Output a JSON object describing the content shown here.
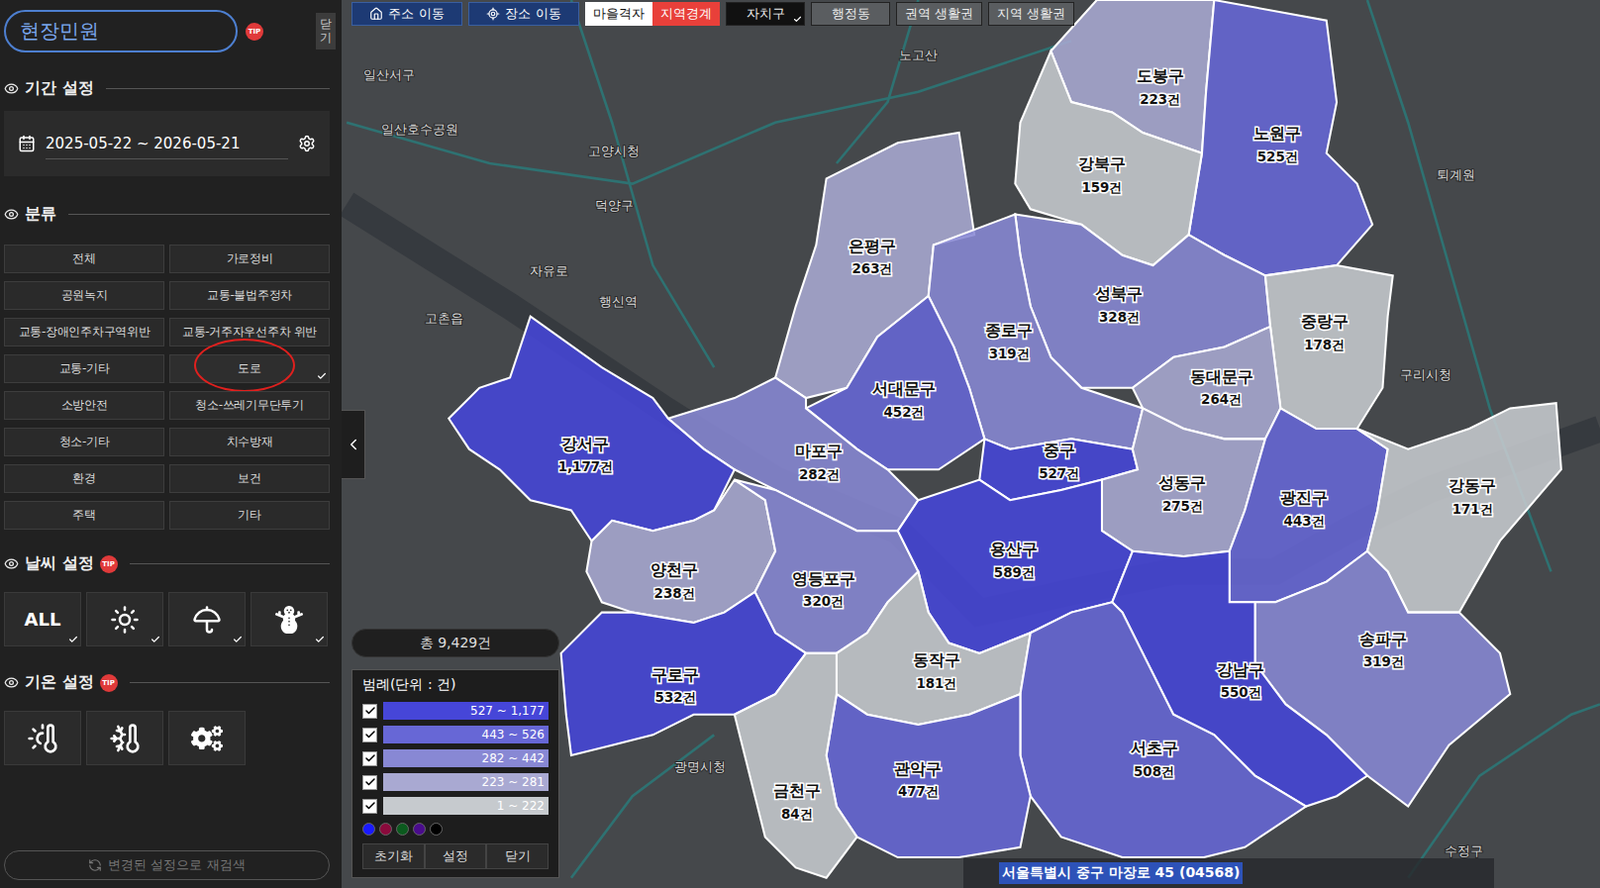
{
  "sidebar": {
    "title": "현장민원",
    "title_badge": "TIP",
    "close_tab": "닫기",
    "period": {
      "title": "기간 설정",
      "range": "2025-05-22 ~ 2026-05-21"
    },
    "category": {
      "title": "분류",
      "items": [
        {
          "label": "전체",
          "selected": false,
          "circled": false
        },
        {
          "label": "가로정비",
          "selected": false,
          "circled": false
        },
        {
          "label": "공원녹지",
          "selected": false,
          "circled": false
        },
        {
          "label": "교통-불법주정차",
          "selected": false,
          "circled": false
        },
        {
          "label": "교통-장애인주차구역위반",
          "selected": false,
          "circled": false
        },
        {
          "label": "교통-거주자우선주차 위반",
          "selected": false,
          "circled": false
        },
        {
          "label": "교통-기타",
          "selected": false,
          "circled": false
        },
        {
          "label": "도로",
          "selected": true,
          "circled": true
        },
        {
          "label": "소방안전",
          "selected": false,
          "circled": false
        },
        {
          "label": "청소-쓰레기무단투기",
          "selected": false,
          "circled": false
        },
        {
          "label": "청소-기타",
          "selected": false,
          "circled": false
        },
        {
          "label": "치수방재",
          "selected": false,
          "circled": false
        },
        {
          "label": "환경",
          "selected": false,
          "circled": false
        },
        {
          "label": "보건",
          "selected": false,
          "circled": false
        },
        {
          "label": "주택",
          "selected": false,
          "circled": false
        },
        {
          "label": "기타",
          "selected": false,
          "circled": false
        }
      ]
    },
    "weather": {
      "title": "날씨 설정",
      "badge": "TIP",
      "items": [
        {
          "kind": "text",
          "label": "ALL",
          "checked": true
        },
        {
          "kind": "sun",
          "checked": true
        },
        {
          "kind": "rain",
          "checked": true
        },
        {
          "kind": "snow",
          "checked": true
        }
      ]
    },
    "temperature": {
      "title": "기온 설정",
      "badge": "TIP",
      "items": [
        {
          "kind": "hot"
        },
        {
          "kind": "cold"
        },
        {
          "kind": "settings"
        }
      ]
    },
    "research_button": "변경된 설정으로 재검색"
  },
  "toolbar": {
    "nav": [
      {
        "label": "주소 이동",
        "kind": "home"
      },
      {
        "label": "장소 이동",
        "kind": "target"
      }
    ],
    "layer": [
      {
        "label": "마을격자",
        "selected": false
      },
      {
        "label": "지역경계",
        "selected": true
      }
    ],
    "levels": [
      {
        "label": "자치구",
        "selected": true
      },
      {
        "label": "행정동",
        "selected": false
      },
      {
        "label": "권역 생활권",
        "selected": false
      },
      {
        "label": "지역 생활권",
        "selected": false
      }
    ]
  },
  "map": {
    "districts": [
      {
        "name": "도봉구",
        "count": "223건"
      },
      {
        "name": "노원구",
        "count": "525건"
      },
      {
        "name": "강북구",
        "count": "159건"
      },
      {
        "name": "은평구",
        "count": "263건"
      },
      {
        "name": "성북구",
        "count": "328건"
      },
      {
        "name": "중랑구",
        "count": "178건"
      },
      {
        "name": "종로구",
        "count": "319건"
      },
      {
        "name": "동대문구",
        "count": "264건"
      },
      {
        "name": "서대문구",
        "count": "452건"
      },
      {
        "name": "마포구",
        "count": "282건"
      },
      {
        "name": "중구",
        "count": "527건"
      },
      {
        "name": "성동구",
        "count": "275건"
      },
      {
        "name": "광진구",
        "count": "443건"
      },
      {
        "name": "강동구",
        "count": "171건"
      },
      {
        "name": "강서구",
        "count": "1,177건"
      },
      {
        "name": "양천구",
        "count": "238건"
      },
      {
        "name": "영등포구",
        "count": "320건"
      },
      {
        "name": "용산구",
        "count": "589건"
      },
      {
        "name": "동작구",
        "count": "181건"
      },
      {
        "name": "구로구",
        "count": "532건"
      },
      {
        "name": "송파구",
        "count": "319건"
      },
      {
        "name": "강남구",
        "count": "550건"
      },
      {
        "name": "서초구",
        "count": "508건"
      },
      {
        "name": "관악구",
        "count": "477건"
      },
      {
        "name": "금천구",
        "count": "84건"
      }
    ],
    "labels": [
      {
        "text": "일산서구"
      },
      {
        "text": "일산호수공원"
      },
      {
        "text": "고양시청"
      },
      {
        "text": "덕양구"
      },
      {
        "text": "행신역"
      },
      {
        "text": "자유로"
      },
      {
        "text": "고촌읍"
      },
      {
        "text": "노고산"
      },
      {
        "text": "구리시청"
      },
      {
        "text": "퇴계원"
      },
      {
        "text": "광명시청"
      },
      {
        "text": "수정구"
      }
    ]
  },
  "total": "총 9,429건",
  "legend": {
    "title": "범례(단위 : 건)",
    "ranges": [
      {
        "label": "527 ~ 1,177",
        "checked": true,
        "color": "#4646d8"
      },
      {
        "label": "443 ~ 526",
        "checked": true,
        "color": "#6767d6"
      },
      {
        "label": "282 ~ 442",
        "checked": true,
        "color": "#8888d4"
      },
      {
        "label": "223 ~ 281",
        "checked": true,
        "color": "#a9a9d2"
      },
      {
        "label": "1 ~ 222",
        "checked": true,
        "color": "#c6cace"
      }
    ],
    "palette": [
      {
        "color": "#1a1aff"
      },
      {
        "color": "#8a0a3c"
      },
      {
        "color": "#0b5a1e"
      },
      {
        "color": "#4a0c8c"
      },
      {
        "color": "#000000"
      }
    ],
    "buttons": [
      "초기화",
      "설정",
      "닫기"
    ]
  },
  "address": "서울특별시 중구 마장로 45 (04568)"
}
